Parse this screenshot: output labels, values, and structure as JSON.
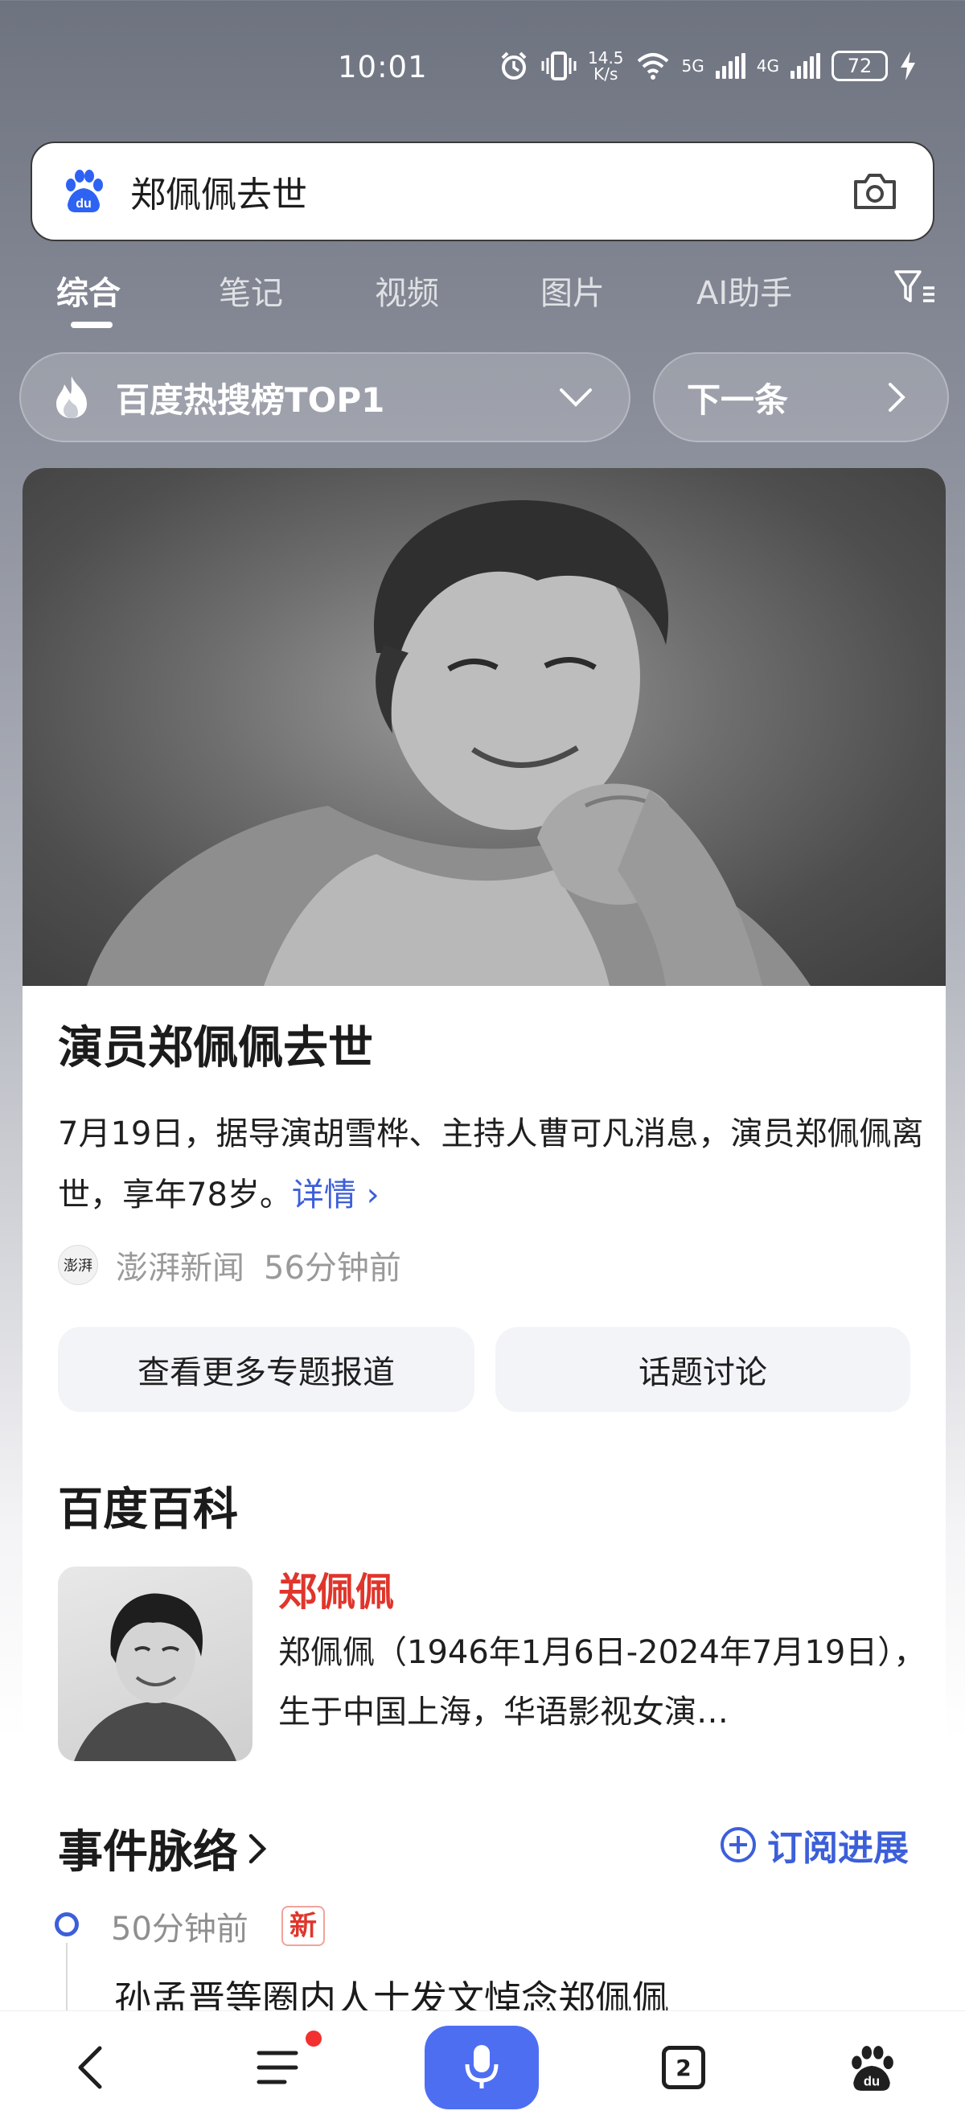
{
  "status_bar": {
    "time": "10:01",
    "network_speed_value": "14.5",
    "network_speed_unit": "K/s",
    "signal_5g": "5G",
    "signal_4g": "4G",
    "battery": "72"
  },
  "search": {
    "query": "郑佩佩去世"
  },
  "tabs": [
    {
      "label": "综合",
      "active": true
    },
    {
      "label": "笔记",
      "active": false
    },
    {
      "label": "视频",
      "active": false
    },
    {
      "label": "图片",
      "active": false
    },
    {
      "label": "AI助手",
      "active": false
    }
  ],
  "hot": {
    "label": "百度热搜榜TOP1",
    "next_label": "下一条"
  },
  "news": {
    "headline": "演员郑佩佩去世",
    "summary": "7月19日，据导演胡雪桦、主持人曹可凡消息，演员郑佩佩离世，享年78岁。",
    "more_label": "详情",
    "source_logo_text": "澎湃",
    "source": "澎湃新闻",
    "time": "56分钟前",
    "btn_more_reports": "查看更多专题报道",
    "btn_discussion": "话题讨论"
  },
  "baike": {
    "section_title": "百度百科",
    "name": "郑佩佩",
    "description": "郑佩佩（1946年1月6日-2024年7月19日），生于中国上海，华语影视女演…"
  },
  "events": {
    "title": "事件脉络",
    "subscribe_label": "订阅进展",
    "items": [
      {
        "time": "50分钟前",
        "badge": "新",
        "text": "孙孟晋等圈内人士发文悼念郑佩佩"
      }
    ]
  },
  "bottom_nav": {
    "open_tabs": "2"
  },
  "colors": {
    "accent_blue": "#4e6ef2",
    "link_blue": "#3c5fd9",
    "name_red": "#e0352b"
  }
}
